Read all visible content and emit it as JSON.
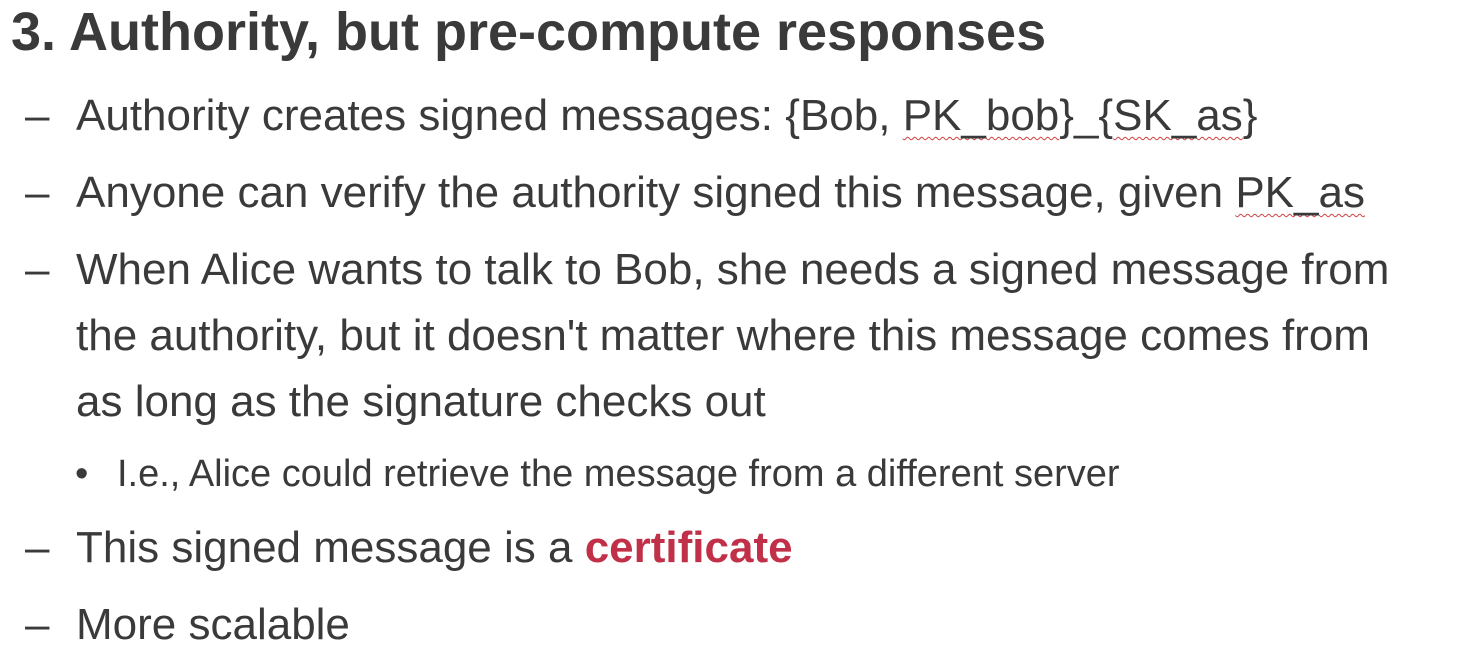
{
  "title": "3. Authority, but pre-compute responses",
  "bullets": {
    "b1": {
      "dash": "–",
      "prefix": "Authority creates signed messages: {Bob, ",
      "flag1": "PK_bob",
      "mid": "}_{",
      "flag2": "SK_as",
      "suffix": "}"
    },
    "b2": {
      "dash": "–",
      "prefix": "Anyone can verify the authority signed this message, given ",
      "flag": "PK_as"
    },
    "b3": {
      "dash": "–",
      "line1": "When Alice wants to talk to Bob, she needs a signed message from",
      "line2": "the authority, but it doesn't matter where this message comes from",
      "line3": "as long as the signature checks out"
    },
    "b3_sub": {
      "dot": "•",
      "text": "I.e., Alice could retrieve the message from a different server"
    },
    "b4": {
      "dash": "–",
      "prefix": "This signed message is a ",
      "emphasis": "certificate"
    },
    "b5": {
      "dash": "–",
      "text": "More scalable"
    }
  },
  "colors": {
    "text": "#3a3a3a",
    "accent": "#c03048",
    "spellcheck": "#d04040"
  }
}
